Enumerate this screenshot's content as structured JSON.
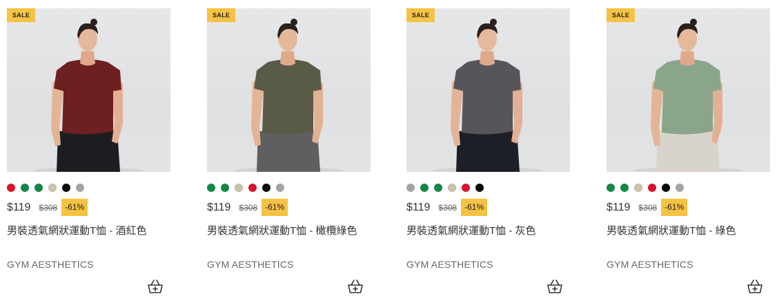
{
  "products": [
    {
      "badge": "SALE",
      "price": "$119",
      "old_price": "$308",
      "discount": "-61%",
      "title": "男裝透氣網狀運動T恤 - 酒紅色",
      "brand": "GYM AESTHETICS",
      "shirt_color": "#6e1f22",
      "pants_color": "#1c1d20",
      "swatch_colors": [
        "#d7152f",
        "#138744",
        "#138744",
        "#cdc2ad",
        "#0a0a0a",
        "#a3a3a3"
      ]
    },
    {
      "badge": "SALE",
      "price": "$119",
      "old_price": "$308",
      "discount": "-61%",
      "title": "男裝透氣網狀運動T恤 - 橄欖綠色",
      "brand": "GYM AESTHETICS",
      "shirt_color": "#5a5b47",
      "pants_color": "#5f5e61",
      "swatch_colors": [
        "#138744",
        "#138744",
        "#cdc2ad",
        "#d7152f",
        "#0a0a0a",
        "#a3a3a3"
      ]
    },
    {
      "badge": "SALE",
      "price": "$119",
      "old_price": "$308",
      "discount": "-61%",
      "title": "男裝透氣網狀運動T恤 - 灰色",
      "brand": "GYM AESTHETICS",
      "shirt_color": "#56565a",
      "pants_color": "#1d1f26",
      "swatch_colors": [
        "#a3a3a3",
        "#138744",
        "#138744",
        "#cdc2ad",
        "#d7152f",
        "#0a0a0a"
      ]
    },
    {
      "badge": "SALE",
      "price": "$119",
      "old_price": "$308",
      "discount": "-61%",
      "title": "男裝透氣網狀運動T恤 - 綠色",
      "brand": "GYM AESTHETICS",
      "shirt_color": "#8aa58a",
      "pants_color": "#d8d4cb",
      "swatch_colors": [
        "#138744",
        "#138744",
        "#cdc2ad",
        "#d7152f",
        "#0a0a0a",
        "#a3a3a3"
      ]
    }
  ],
  "icons": {
    "cart": "add-to-cart-basket-icon"
  },
  "colors": {
    "accent": "#f5c244",
    "text": "#333333",
    "muted": "#666666"
  }
}
